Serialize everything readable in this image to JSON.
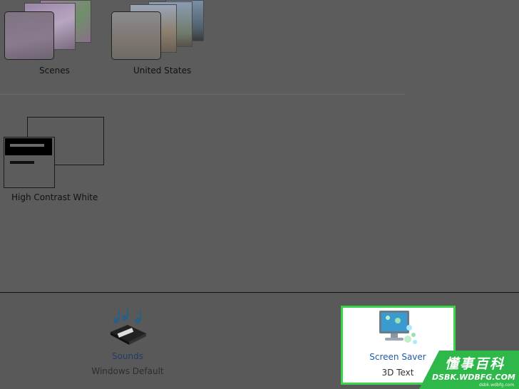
{
  "themes": {
    "items": [
      {
        "label": "Scenes"
      },
      {
        "label": "United States"
      },
      {
        "label": "High Contrast White"
      }
    ]
  },
  "bottom_bar": {
    "sounds": {
      "title": "Sounds",
      "subtitle": "Windows Default",
      "icon": "speaker-notes-icon"
    },
    "screen_saver": {
      "title": "Screen Saver",
      "subtitle": "3D Text",
      "icon": "monitor-bubbles-icon"
    }
  },
  "watermark": {
    "chinese": "懂事百科",
    "site": "DSBK.WDBFG.COM",
    "site_small": "dsbk.wdbfg.com"
  },
  "colors": {
    "highlight_border": "#3bd34a",
    "link_text": "#1f3d66"
  }
}
